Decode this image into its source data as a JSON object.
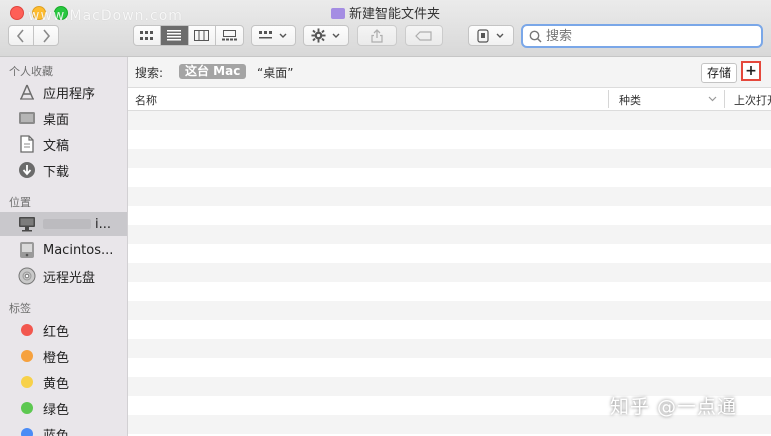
{
  "window": {
    "title": "新建智能文件夹",
    "watermark": "www.MacDown.com"
  },
  "toolbar": {
    "back_icon": "chevron-left-icon",
    "forward_icon": "chevron-right-icon",
    "view_modes": [
      "icon-view",
      "list-view",
      "column-view",
      "gallery-view"
    ],
    "active_view": "list-view",
    "group_icon": "group-icon",
    "action_icon": "gear-icon",
    "share_icon": "share-icon",
    "tag_icon": "tag-icon",
    "path_icon": "path-icon",
    "search_placeholder": "搜索"
  },
  "sidebar": {
    "sections": {
      "favorites": "个人收藏",
      "locations": "位置",
      "tags": "标签"
    },
    "favorites": [
      {
        "label": "应用程序",
        "icon": "applications-icon"
      },
      {
        "label": "桌面",
        "icon": "desktop-icon"
      },
      {
        "label": "文稿",
        "icon": "documents-icon"
      },
      {
        "label": "下载",
        "icon": "downloads-icon"
      }
    ],
    "locations": [
      {
        "label": "i...",
        "icon": "computer-icon",
        "selected": true
      },
      {
        "label": "Macintos...",
        "icon": "hard-drive-icon"
      },
      {
        "label": "远程光盘",
        "icon": "remote-disc-icon"
      }
    ],
    "tags": [
      {
        "label": "红色",
        "color": "#f2574e"
      },
      {
        "label": "橙色",
        "color": "#f6a13e"
      },
      {
        "label": "黄色",
        "color": "#f7d14a"
      },
      {
        "label": "绿色",
        "color": "#5dc851"
      },
      {
        "label": "蓝色",
        "color": "#4b8cf6"
      }
    ]
  },
  "search_scope": {
    "label": "搜索:",
    "active": "这台 Mac",
    "other": "“桌面”",
    "save_label": "存储",
    "add_label": "+"
  },
  "columns": [
    "名称",
    "种类",
    "上次打开"
  ],
  "credit": "知乎 @一点通"
}
